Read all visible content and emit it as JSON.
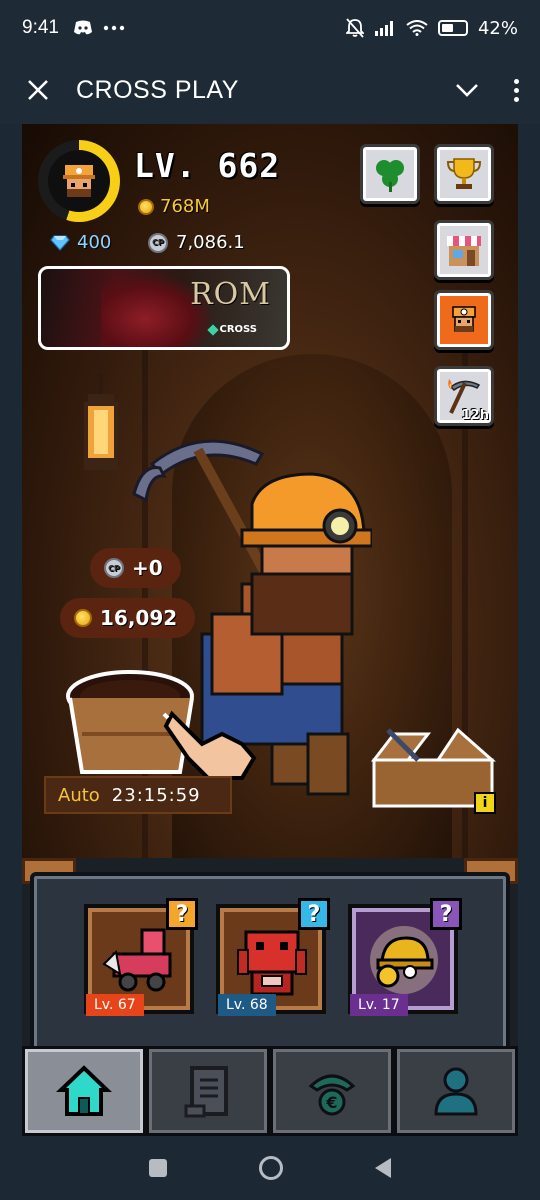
{
  "status_bar": {
    "time": "9:41",
    "battery": "42%",
    "battery_level": 0.42
  },
  "app_bar": {
    "title": "CROSS PLAY"
  },
  "hud": {
    "level": "LV. 662",
    "gold": "768M",
    "gems": "400",
    "cp": "7,086.1",
    "level_progress": 0.55
  },
  "banner": {
    "title": "ROM",
    "brand": "CROSS"
  },
  "side_buttons": {
    "pickaxe_timer": "12h"
  },
  "floating": {
    "cp_gain": "+0",
    "gold_gain": "16,092"
  },
  "auto": {
    "label": "Auto",
    "timer": "23:15:59"
  },
  "slots": [
    {
      "level": "Lv. 67",
      "level_color": "#e8441a",
      "badge_color": "#f4a62b"
    },
    {
      "level": "Lv. 68",
      "level_color": "#1e5a86",
      "badge_color": "#35b7e8"
    },
    {
      "level": "Lv. 17",
      "level_color": "#6a2f8f",
      "badge_color": "#8a55b8"
    }
  ],
  "toolbox_info": "i",
  "colors": {
    "accent_gold": "#f7c838",
    "gem_blue": "#8fd3ff",
    "orange_button": "#f06a1c"
  }
}
